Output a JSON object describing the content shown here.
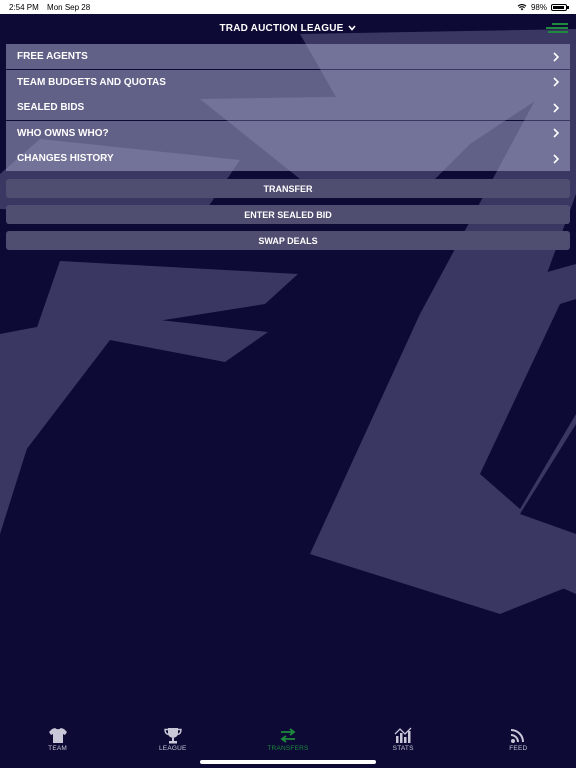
{
  "status_bar": {
    "time": "2:54 PM",
    "date": "Mon Sep 28",
    "battery": "98%"
  },
  "header": {
    "title": "TRAD AUCTION LEAGUE"
  },
  "menu": [
    {
      "label": "FREE AGENTS"
    },
    {
      "label": "TEAM BUDGETS AND QUOTAS"
    },
    {
      "label": "SEALED BIDS"
    },
    {
      "label": "WHO OWNS WHO?"
    },
    {
      "label": "CHANGES HISTORY"
    }
  ],
  "actions": {
    "transfer": "TRANSFER",
    "sealed_bid": "ENTER SEALED BID",
    "swap_deals": "SWAP DEALS"
  },
  "tabs": {
    "team": "TEAM",
    "league": "LEAGUE",
    "transfers": "TRANSFERS",
    "stats": "STATS",
    "feed": "FEED",
    "active": "transfers"
  },
  "colors": {
    "accent": "#1e8a3c",
    "background": "#0d0a35"
  }
}
